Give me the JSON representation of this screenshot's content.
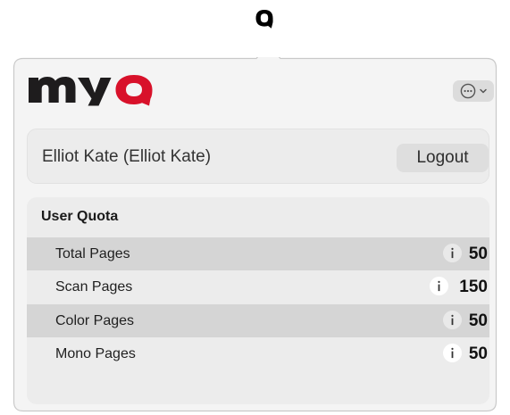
{
  "app": {
    "brand": "MyQ",
    "icons": {
      "menubar": "myq-q-icon",
      "more": "ellipsis-circle-icon",
      "dropdown": "chevron-down-icon",
      "info": "info-icon"
    },
    "colors": {
      "brand_black": "#1e1c1d",
      "brand_red": "#d8112a"
    }
  },
  "user": {
    "display_name": "Elliot Kate (Elliot Kate)",
    "logout_label": "Logout"
  },
  "quota": {
    "title": "User Quota",
    "rows": [
      {
        "label": "Total Pages",
        "value": "50"
      },
      {
        "label": "Scan Pages",
        "value": "150"
      },
      {
        "label": "Color Pages",
        "value": "50"
      },
      {
        "label": "Mono Pages",
        "value": "50"
      }
    ]
  }
}
